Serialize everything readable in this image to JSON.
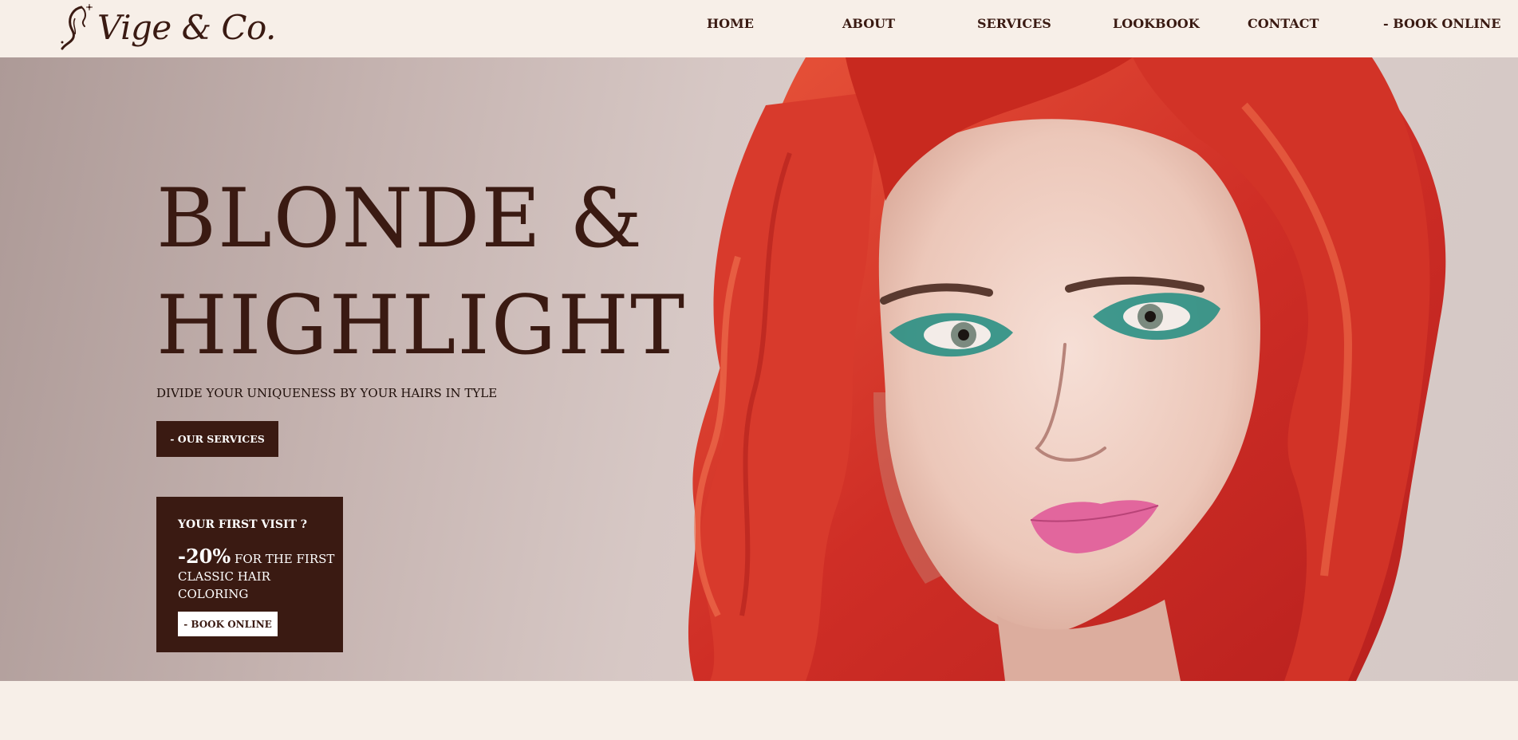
{
  "brand": {
    "name": "Vige & Co."
  },
  "nav": {
    "items": [
      {
        "label": "HOME"
      },
      {
        "label": "ABOUT"
      },
      {
        "label": "SERVICES"
      },
      {
        "label": "LOOKBOOK"
      },
      {
        "label": "CONTACT"
      },
      {
        "label": "- BOOK ONLINE"
      }
    ]
  },
  "hero": {
    "headline_line1": "BLONDE &",
    "headline_line2": "HIGHLIGHT",
    "tagline": "DIVIDE YOUR UNIQUENESS BY YOUR HAIRS IN TYLE",
    "services_button": "- OUR SERVICES"
  },
  "promo": {
    "title": "YOUR FIRST VISIT ?",
    "discount": "-20%",
    "text": "FOR THE FIRST CLASSIC HAIR COLORING",
    "button": "- BOOK ONLINE"
  },
  "colors": {
    "primary": "#3a1a12",
    "background": "#f7efe8",
    "hair": "#d2362a",
    "eyeshadow": "#1f8c80",
    "lips": "#e2669d"
  },
  "icons": {
    "logo_mark": "woman-silhouette-icon"
  }
}
